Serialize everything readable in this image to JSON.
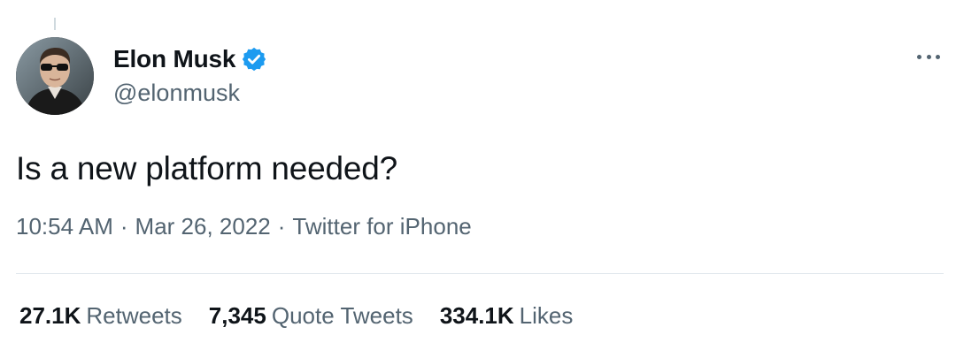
{
  "tweet": {
    "author": {
      "display_name": "Elon Musk",
      "handle": "@elonmusk",
      "verified": true,
      "verified_color": "#1d9bf0"
    },
    "text": "Is a new platform needed?",
    "meta": {
      "time": "10:54 AM",
      "separator": "·",
      "date": "Mar 26, 2022",
      "source": "Twitter for iPhone"
    },
    "stats": [
      {
        "value": "27.1K",
        "label": "Retweets"
      },
      {
        "value": "7,345",
        "label": "Quote Tweets"
      },
      {
        "value": "334.1K",
        "label": "Likes"
      }
    ],
    "more_icon": "more-horizontal-icon"
  }
}
